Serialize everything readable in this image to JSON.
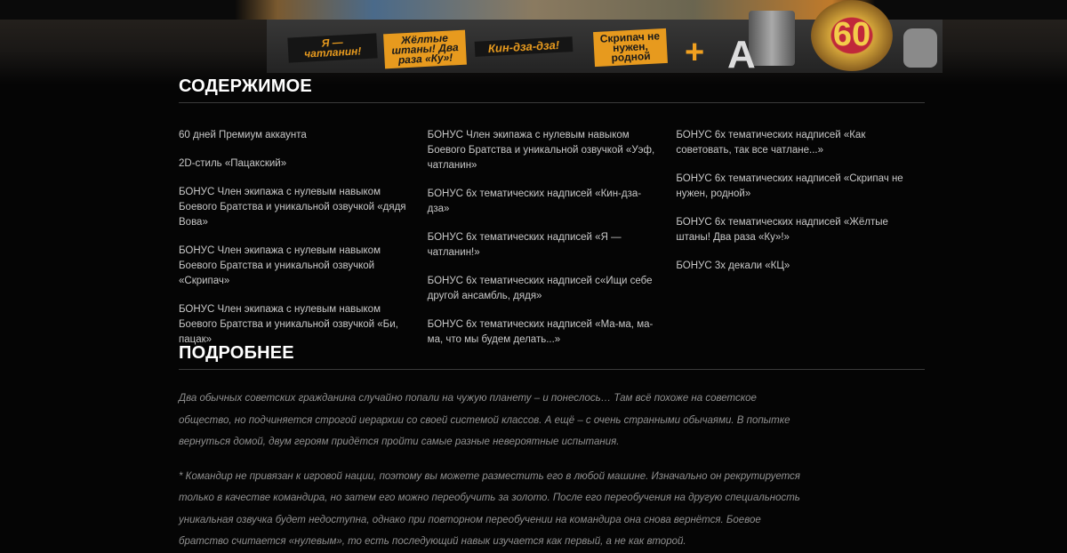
{
  "banner": {
    "stickers": [
      "Я — чатланин!",
      "Жёлтые штаны! Два раза «Ку»!",
      "Кин-дза-дза!",
      "Скрипач не нужен, родной"
    ],
    "plus": "+",
    "medal_days": "60",
    "letter": "A"
  },
  "contents": {
    "title": "СОДЕРЖИМОЕ",
    "columns": [
      [
        "60 дней Премиум аккаунта",
        "2D-стиль «Пацакский»",
        "БОНУС Член экипажа с нулевым навыком Боевого Братства и уникальной озвучкой «дядя Вова»",
        "БОНУС Член экипажа с нулевым навыком Боевого Братства и уникальной озвучкой «Скрипач»",
        "БОНУС Член экипажа с нулевым навыком Боевого Братства и уникальной озвучкой «Би, пацак»"
      ],
      [
        "БОНУС Член экипажа с нулевым навыком Боевого Братства и уникальной озвучкой «Уэф, чатланин»",
        "БОНУС 6х тематических надписей «Кин-дза-дза»",
        "БОНУС 6х тематических надписей «Я — чатланин!»",
        "БОНУС 6х тематических надписей с«Ищи себе другой ансамбль, дядя»",
        "БОНУС 6х тематических надписей «Ма-ма, ма-ма, что мы будем делать...»"
      ],
      [
        "БОНУС 6х тематических надписей «Как советовать, так все чатлане...»",
        "БОНУС 6х тематических надписей «Скрипач не нужен, родной»",
        "БОНУС 6х тематических надписей «Жёлтые штаны! Два раза «Ку»!»",
        "БОНУС 3х декали «КЦ»"
      ]
    ]
  },
  "details": {
    "title": "ПОДРОБНЕЕ",
    "paragraphs": [
      "Два обычных советских гражданина случайно попали на чужую планету – и понеслось… Там всё похоже на советское общество, но подчиняется строгой иерархии со своей системой классов. А ещё – с очень странными обычаями. В попытке вернуться домой, двум героям придётся пройти самые разные невероятные испытания.",
      "* Командир не привязан к игровой нации, поэтому вы можете разместить его в любой машине. Изначально он рекрутируется только в качестве командира, но затем его можно переобучить за золото. После его переобучения на другую специальность уникальная озвучка будет недоступна, однако при повторном переобучении на командира она снова вернётся. Боевое братство считается «нулевым», то есть последующий навык изучается как первый, а не как второй."
    ]
  }
}
